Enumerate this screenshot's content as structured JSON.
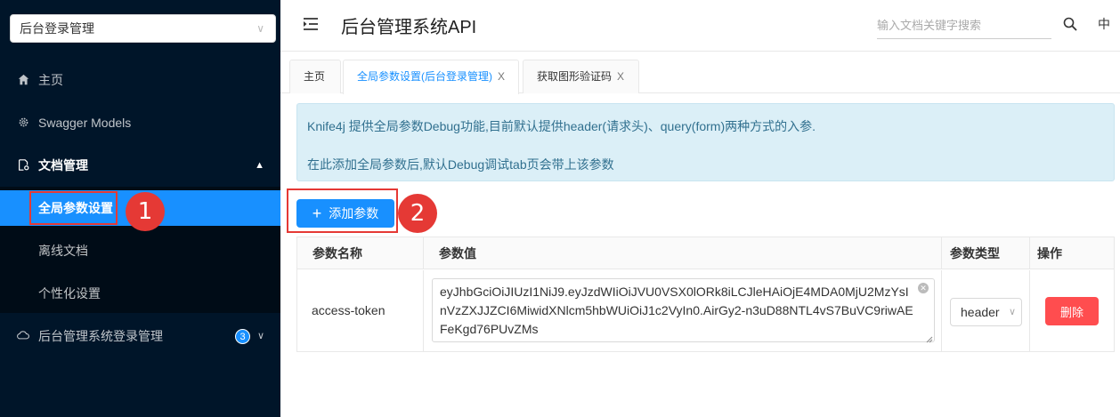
{
  "sidebar": {
    "group_select": {
      "value": "后台登录管理",
      "arrow": "chevron-down-icon"
    },
    "items": [
      {
        "label": "主页",
        "icon": "home-icon"
      },
      {
        "label": "Swagger Models",
        "icon": "settings-gear-icon"
      },
      {
        "label": "文档管理",
        "icon": "document-settings-icon",
        "expanded": true
      },
      {
        "label": "全局参数设置",
        "active": true
      },
      {
        "label": "离线文档"
      },
      {
        "label": "个性化设置"
      },
      {
        "label": "后台管理系统登录管理",
        "icon": "cloud-icon",
        "badge": "3"
      }
    ]
  },
  "header": {
    "title": "后台管理系统API",
    "search_placeholder": "输入文档关键字搜索",
    "lang": "中"
  },
  "tabs": [
    {
      "label": "主页"
    },
    {
      "label": "全局参数设置(后台登录管理)",
      "closable": true,
      "active": true
    },
    {
      "label": "获取图形验证码",
      "closable": true
    }
  ],
  "tab_close_glyph": "X",
  "alert": {
    "line1": "Knife4j 提供全局参数Debug功能,目前默认提供header(请求头)、query(form)两种方式的入参.",
    "line2": "在此添加全局参数后,默认Debug调试tab页会带上该参数"
  },
  "add_button_label": "添加参数",
  "table": {
    "columns": [
      "参数名称",
      "参数值",
      "参数类型",
      "操作"
    ],
    "rows": [
      {
        "name": "access-token",
        "value": "eyJhbGciOiJIUzI1NiJ9.eyJzdWIiOiJVU0VSX0lORk8iLCJleHAiOjE4MDA0MjU2MzYsInVzZXJJZCI6MiwidXNlcm5hbWUiOiJ1c2VyIn0.AirGy2-n3uD88NTL4vS7BuVC9riwAEFeKgd76PUvZMs",
        "type": "header",
        "action": "删除"
      }
    ]
  },
  "annotations": {
    "marker1": "1",
    "marker2": "2"
  },
  "colors": {
    "sidebar_bg": "#001529",
    "primary": "#1890ff",
    "danger": "#ff4d4f",
    "marker": "#e53935"
  }
}
